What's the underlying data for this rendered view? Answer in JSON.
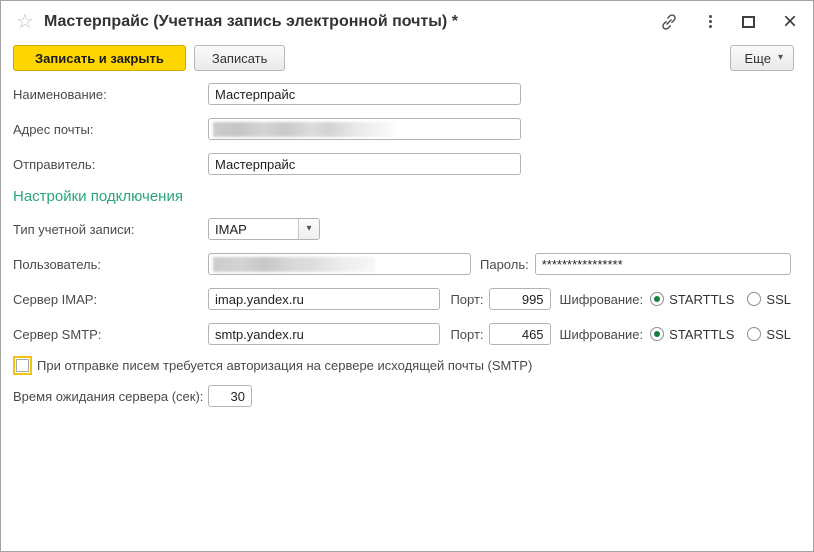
{
  "window": {
    "title": "Мастерпрайс (Учетная запись электронной почты) *"
  },
  "icons": {
    "favorite_star": "☆",
    "maximize": "",
    "close": "×",
    "dropdown_caret": "▾"
  },
  "toolbar": {
    "save_close": "Записать и закрыть",
    "save": "Записать",
    "more": "Еще"
  },
  "fields": {
    "name": {
      "label": "Наименование:",
      "value": "Мастерпрайс"
    },
    "email": {
      "label": "Адрес почты:",
      "redacted": true
    },
    "sender": {
      "label": "Отправитель:",
      "value": "Мастерпрайс"
    },
    "section_title": "Настройки подключения",
    "account_type": {
      "label": "Тип учетной записи:",
      "value": "IMAP"
    },
    "user": {
      "label": "Пользователь:",
      "redacted": true
    },
    "password": {
      "label": "Пароль:",
      "value": "****************"
    },
    "imap_server": {
      "label": "Сервер IMAP:",
      "value": "imap.yandex.ru",
      "port_label": "Порт:",
      "port": "995",
      "encryption_label": "Шифрование:",
      "encryption_options": [
        "STARTTLS",
        "SSL"
      ],
      "encryption_selected": "STARTTLS"
    },
    "smtp_server": {
      "label": "Сервер SMTP:",
      "value": "smtp.yandex.ru",
      "port_label": "Порт:",
      "port": "465",
      "encryption_label": "Шифрование:",
      "encryption_options": [
        "STARTTLS",
        "SSL"
      ],
      "encryption_selected": "STARTTLS"
    },
    "smtp_auth": {
      "label": "При отправке писем требуется авторизация на сервере исходящей почты (SMTP)",
      "checked": false
    },
    "timeout": {
      "label": "Время ожидания сервера (сек):",
      "value": "30"
    }
  },
  "colors": {
    "primary_button": "#ffd600",
    "section_header": "#2ba579",
    "radio_selected": "#15803d",
    "focus_outline": "#f2c411"
  }
}
